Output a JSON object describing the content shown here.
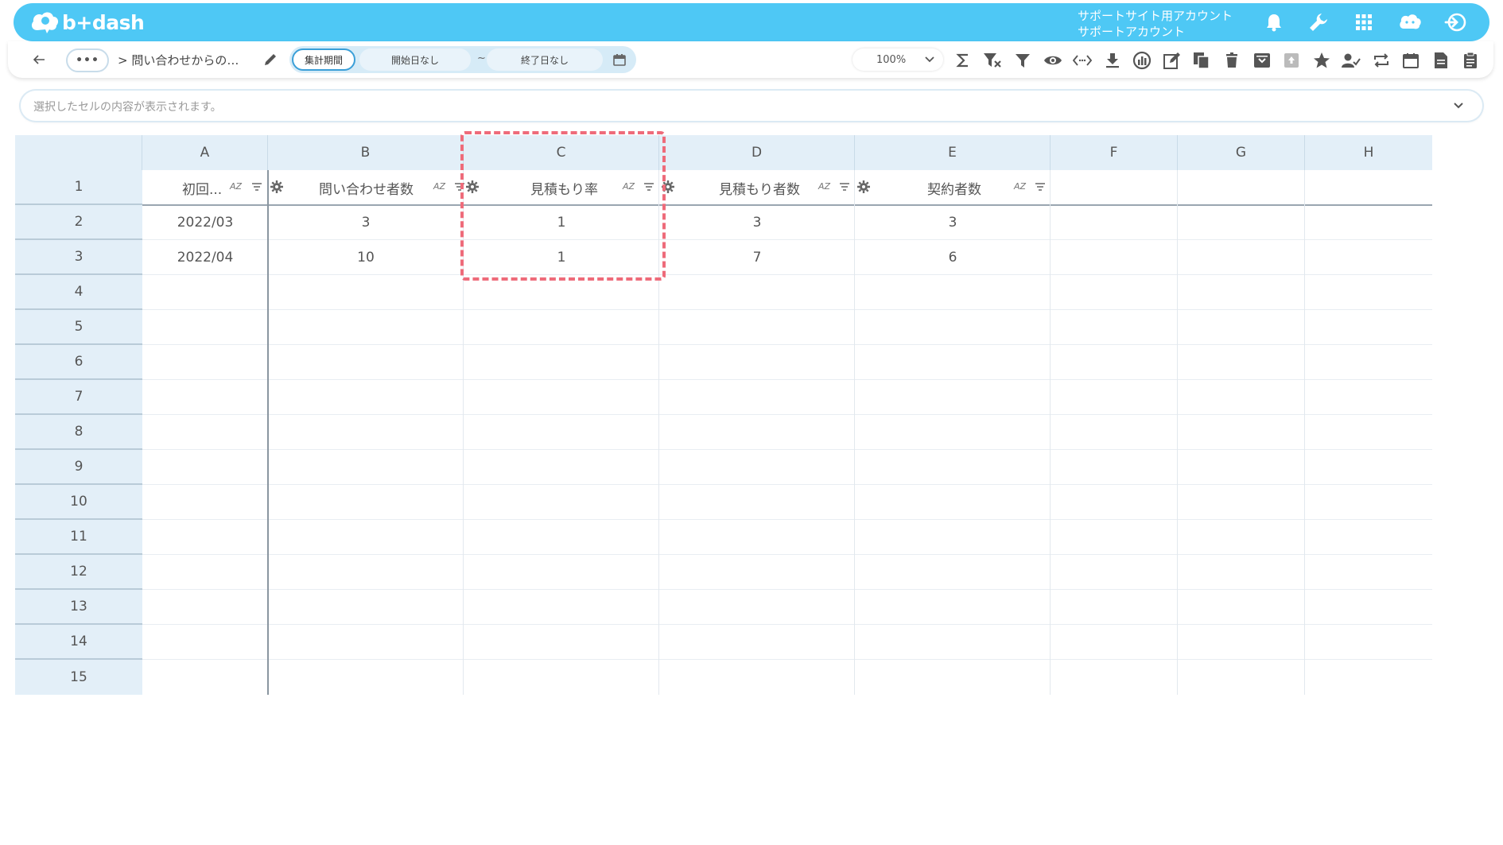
{
  "app": {
    "brand": "b+dash",
    "account_line1": "サポートサイト用アカウント",
    "account_line2": "サポートアカウント",
    "top_icons": [
      "bell-icon",
      "wrench-icon",
      "apps-grid-icon",
      "support-cloud-icon",
      "logout-icon"
    ]
  },
  "toolbar": {
    "more_label": "•••",
    "breadcrumb": "> 問い合わせからの…",
    "period_label": "集計期間",
    "start_date": "開始日なし",
    "tilde": "~",
    "end_date": "終了日なし",
    "zoom": "100%",
    "tools": [
      "sigma-icon",
      "filter-clear-icon",
      "filter-icon",
      "eye-icon",
      "code-icon",
      "download-icon",
      "chart-icon",
      "edit-icon",
      "copy-icon",
      "trash-icon",
      "archive-icon",
      "upload-icon",
      "star-icon",
      "user-check-icon",
      "sync-icon",
      "calendar-icon",
      "document-icon",
      "clipboard-icon"
    ]
  },
  "formula_bar": {
    "placeholder": "選択したセルの内容が表示されます。"
  },
  "sheet": {
    "columns": [
      "A",
      "B",
      "C",
      "D",
      "E",
      "F",
      "G",
      "H"
    ],
    "rows": [
      "1",
      "2",
      "3",
      "4",
      "5",
      "6",
      "7",
      "8",
      "9",
      "10",
      "11",
      "12",
      "13",
      "14",
      "15"
    ],
    "header_fields": [
      "初回...",
      "問い合わせ者数",
      "見積もり率",
      "見積もり者数",
      "契約者数"
    ],
    "sort_label": "AZ",
    "data": [
      [
        "2022/03",
        "3",
        "1",
        "3",
        "3"
      ],
      [
        "2022/04",
        "10",
        "1",
        "7",
        "6"
      ]
    ]
  },
  "colors": {
    "brand": "#4ec8f5",
    "header_bg": "#e3eff8",
    "highlight": "#ee6b7a"
  }
}
